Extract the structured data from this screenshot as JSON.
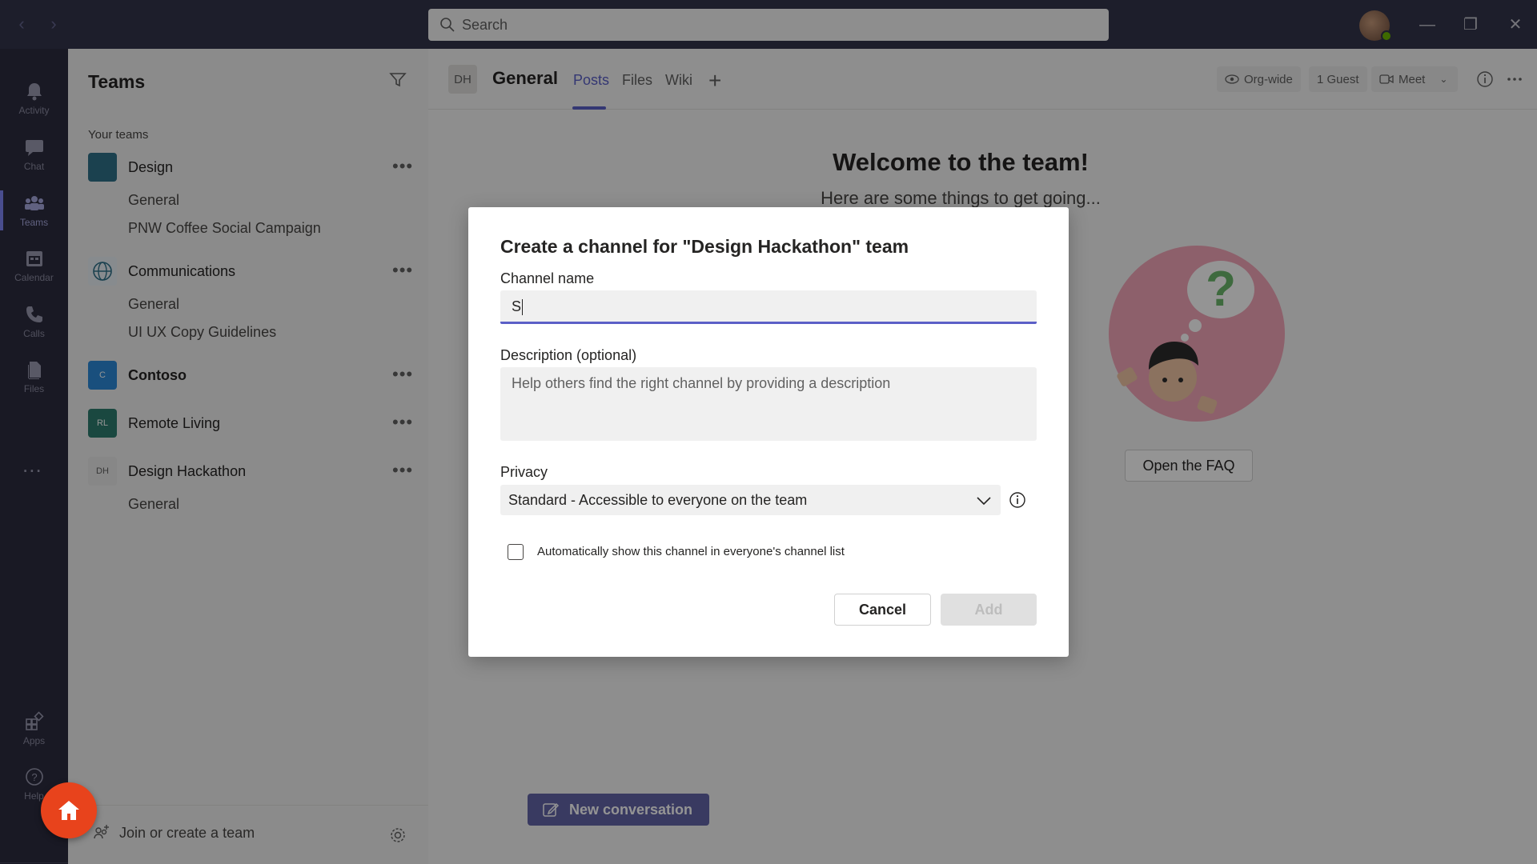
{
  "search": {
    "placeholder": "Search"
  },
  "rail": {
    "items": [
      {
        "label": "Activity",
        "icon": "bell-icon"
      },
      {
        "label": "Chat",
        "icon": "chat-icon"
      },
      {
        "label": "Teams",
        "icon": "teams-icon"
      },
      {
        "label": "Calendar",
        "icon": "calendar-icon"
      },
      {
        "label": "Calls",
        "icon": "phone-icon"
      },
      {
        "label": "Files",
        "icon": "files-icon"
      }
    ],
    "more": "...",
    "apps_label": "Apps",
    "help_label": "Help"
  },
  "teams_panel": {
    "title": "Teams",
    "section_label": "Your teams",
    "teams": [
      {
        "name": "Design",
        "logo_text": "",
        "color": "#2f7089",
        "channels": [
          "General",
          "PNW Coffee Social Campaign"
        ]
      },
      {
        "name": "Communications",
        "logo_text": "",
        "color": "#e8f0f5",
        "channels": [
          "General",
          "UI UX Copy Guidelines"
        ]
      },
      {
        "name": "Contoso",
        "logo_text": "C",
        "color": "#2b88d8",
        "channels": []
      },
      {
        "name": "Remote Living",
        "logo_text": "RL",
        "color": "#2d7d6e",
        "channels": []
      },
      {
        "name": "Design Hackathon",
        "logo_text": "DH",
        "color": "#e8e8e8",
        "channels": [
          "General"
        ]
      }
    ],
    "more_label": "•••",
    "join_label": "Join or create a team"
  },
  "channel_header": {
    "badge": "DH",
    "title": "General",
    "tabs": [
      "Posts",
      "Files",
      "Wiki"
    ],
    "active_tab": "Posts",
    "org_wide": "Org-wide",
    "guests": "1 Guest",
    "meet": "Meet"
  },
  "content": {
    "welcome": "Welcome to the team!",
    "subtitle": "Here are some things to get going...",
    "faq_button": "Open the FAQ",
    "new_conversation": "New conversation"
  },
  "dialog": {
    "title": "Create a channel for \"Design Hackathon\" team",
    "channel_name_label": "Channel name",
    "channel_name_value": "S",
    "description_label": "Description (optional)",
    "description_placeholder": "Help others find the right channel by providing a description",
    "privacy_label": "Privacy",
    "privacy_value": "Standard - Accessible to everyone on the team",
    "auto_show_label": "Automatically show this channel in everyone's channel list",
    "auto_show_checked": false,
    "cancel_label": "Cancel",
    "add_label": "Add"
  },
  "colors": {
    "accent": "#5b5fc7",
    "titlebar": "#33344a",
    "rail": "#2c2c3f",
    "fab": "#e8431c"
  }
}
